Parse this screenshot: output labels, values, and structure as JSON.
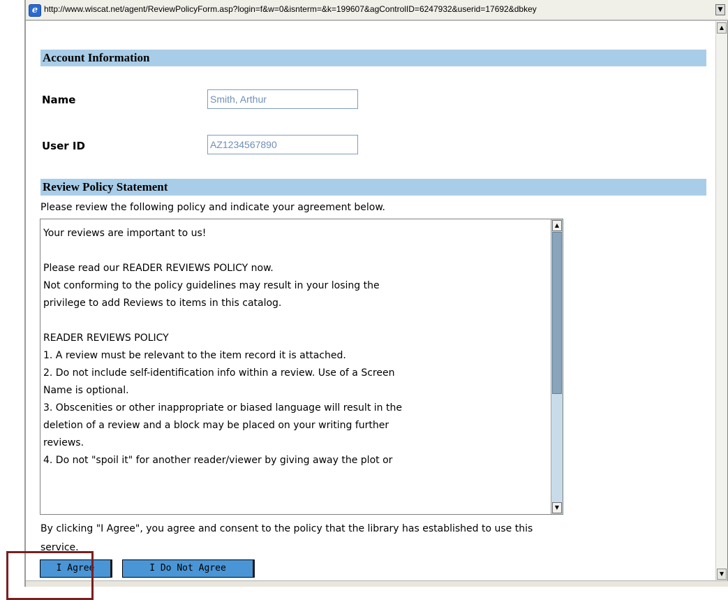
{
  "browser": {
    "icon": "ie-icon",
    "url": "http://www.wiscat.net/agent/ReviewPolicyForm.asp?login=f&w=0&isnterm=&k=199607&agControlID=6247932&userid=17692&dbkey"
  },
  "account_section": {
    "heading": "Account Information",
    "name_label": "Name",
    "name_value": "Smith, Arthur",
    "userid_label": "User ID",
    "userid_value": "AZ1234567890"
  },
  "policy_section": {
    "heading": "Review Policy Statement",
    "intro": "Please review the following policy and indicate your agreement below.",
    "text_lines": [
      "Your reviews are important to us!",
      "",
      "Please read our READER REVIEWS POLICY now.",
      "Not conforming to the policy guidelines may result in your losing the",
      "privilege to add Reviews to items in this catalog.",
      "",
      "READER REVIEWS POLICY",
      "1.  A review must be relevant to the item record it is attached.",
      "2.  Do not include self-identification info within a review.  Use of a Screen",
      "Name is optional.",
      "3.  Obscenities or other inappropriate or biased language will result in the",
      "deletion of a review and a block may be placed on your writing further",
      "reviews.",
      "4.  Do not \"spoil it\" for another reader/viewer by giving away the plot or"
    ],
    "agreement_note": "By clicking \"I Agree\", you agree and consent to the policy that the library has established to use this service."
  },
  "buttons": {
    "agree": "I Agree",
    "disagree": "I Do Not Agree"
  },
  "colors": {
    "section_bar": "#a8cde8",
    "button": "#4a95d6",
    "highlight": "#7a1f1f"
  }
}
